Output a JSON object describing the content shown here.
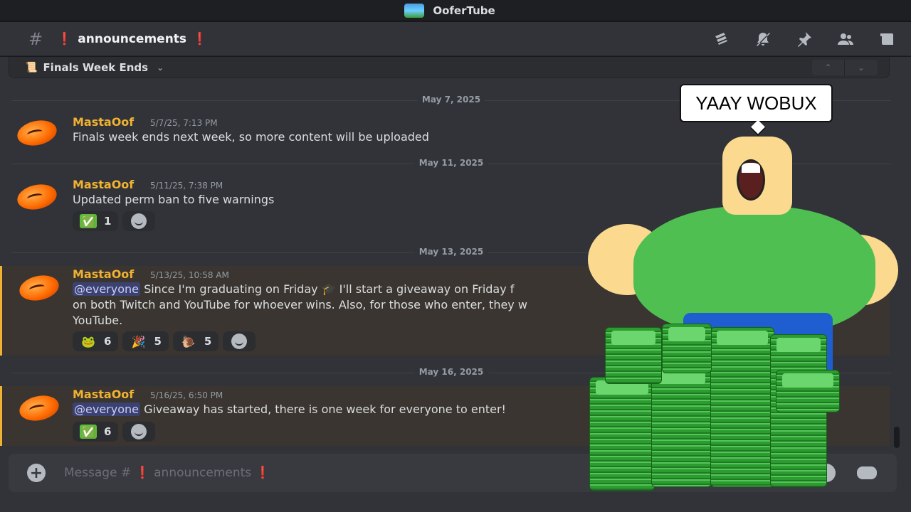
{
  "window": {
    "title": "OoferTube"
  },
  "channel": {
    "hash": "#",
    "prefix_mark": "❗",
    "name": "announcements",
    "suffix_mark": "❗"
  },
  "thread": {
    "title": "Finals Week Ends"
  },
  "dividers": [
    "May 7, 2025",
    "May 11, 2025",
    "May 13, 2025",
    "May 16, 2025"
  ],
  "messages": [
    {
      "author": "MastaOof",
      "timestamp": "5/7/25, 7:13 PM",
      "text": "Finals week ends next week, so more content will be uploaded"
    },
    {
      "author": "MastaOof",
      "timestamp": "5/11/25, 7:38 PM",
      "text": "Updated perm ban to five warnings",
      "reactions": [
        {
          "emoji": "✅",
          "count": "1"
        }
      ]
    },
    {
      "author": "MastaOof",
      "timestamp": "5/13/25, 10:58 AM",
      "mention": "@everyone",
      "text_line1": "Since I'm graduating on Friday 🎓 I'll start a giveaway on Friday f",
      "text_line2": "on both Twitch and YouTube for whoever wins. Also, for those who enter, they w",
      "text_line3": "YouTube.",
      "reactions": [
        {
          "emoji": "🐸",
          "count": "6"
        },
        {
          "emoji": "🎉",
          "count": "5"
        },
        {
          "emoji": "🐌",
          "count": "5"
        }
      ]
    },
    {
      "author": "MastaOof",
      "timestamp": "5/16/25, 6:50 PM",
      "mention": "@everyone",
      "text": "Giveaway has started, there is one week for everyone to enter!",
      "reactions": [
        {
          "emoji": "✅",
          "count": "6"
        }
      ]
    }
  ],
  "composer": {
    "placeholder": "Message # ❗ announcements ❗"
  },
  "meme": {
    "speech": "YAAY WOBUX"
  },
  "colors": {
    "author": "#f0b232",
    "mention_bg": "#3a3530",
    "mention_bar": "#f0b232",
    "background": "#313338"
  }
}
